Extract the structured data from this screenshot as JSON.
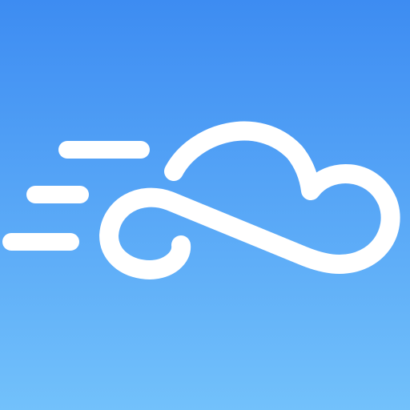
{
  "icon": {
    "name": "windy-cloud-app-icon",
    "glyph": "cloud-with-wind-streaks-icon",
    "background_top": "#3d8cf2",
    "background_bottom": "#72c1fb",
    "glyph_color": "#ffffff"
  }
}
